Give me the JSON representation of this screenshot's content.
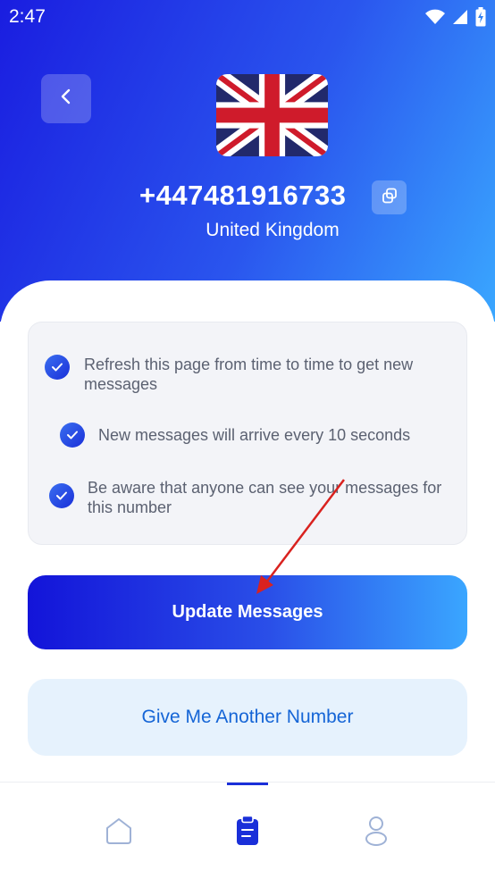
{
  "status_bar": {
    "time": "2:47",
    "icons": [
      "wifi-icon",
      "signal-icon",
      "battery-charging-icon"
    ]
  },
  "header": {
    "back_icon": "chevron-left-icon",
    "flag": "united-kingdom-flag",
    "phone_number": "+447481916733",
    "copy_icon": "copy-icon",
    "country": "United Kingdom"
  },
  "info": {
    "items": [
      "Refresh this page from time to time to get new messages",
      "New messages will arrive every 10 seconds",
      "Be aware that anyone can see your messages for this number"
    ]
  },
  "actions": {
    "update_label": "Update Messages",
    "another_label": "Give Me Another Number"
  },
  "nav": {
    "items": [
      "home-icon",
      "clipboard-icon",
      "profile-icon"
    ],
    "active_index": 1
  },
  "colors": {
    "accent": "#1a2fd9",
    "gradient_start": "#1314d9",
    "gradient_end": "#3aa6ff",
    "secondary_button_bg": "#e6f2fd",
    "secondary_button_text": "#1565d6",
    "annotation_arrow": "#d9221f"
  }
}
